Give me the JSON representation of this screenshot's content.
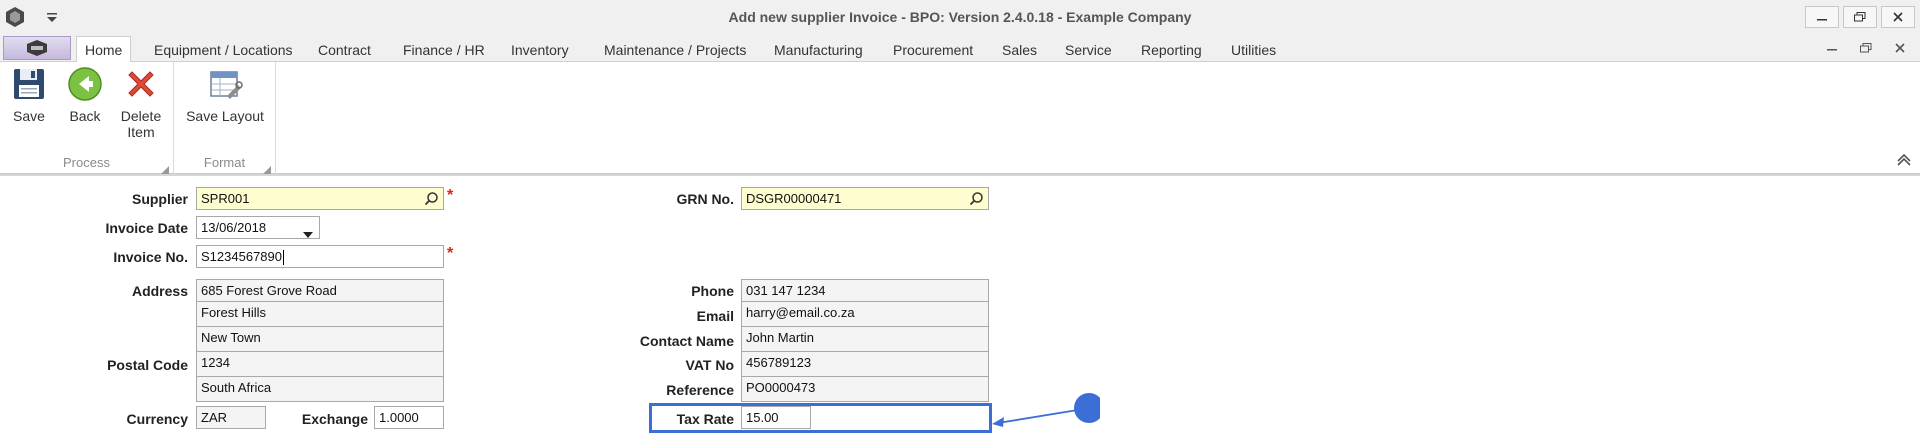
{
  "window": {
    "title": "Add new supplier Invoice - BPO: Version 2.4.0.18 - Example Company"
  },
  "tabs": [
    {
      "label": "Home",
      "active": true
    },
    {
      "label": "Equipment / Locations"
    },
    {
      "label": "Contract"
    },
    {
      "label": "Finance / HR"
    },
    {
      "label": "Inventory"
    },
    {
      "label": "Maintenance / Projects"
    },
    {
      "label": "Manufacturing"
    },
    {
      "label": "Procurement"
    },
    {
      "label": "Sales"
    },
    {
      "label": "Service"
    },
    {
      "label": "Reporting"
    },
    {
      "label": "Utilities"
    }
  ],
  "ribbon": {
    "process": {
      "label": "Process",
      "save": "Save",
      "back": "Back",
      "delete": "Delete Item"
    },
    "format": {
      "label": "Format",
      "save_layout": "Save Layout"
    }
  },
  "form": {
    "supplier": {
      "label": "Supplier",
      "value": "SPR001"
    },
    "invoice_date": {
      "label": "Invoice Date",
      "value": "13/06/2018"
    },
    "invoice_no": {
      "label": "Invoice No.",
      "value": "S1234567890"
    },
    "address": {
      "label": "Address",
      "line1": "685 Forest Grove Road",
      "line2": "Forest Hills",
      "line3": "New Town"
    },
    "postal_code": {
      "label": "Postal Code",
      "value": "1234",
      "country": "South Africa"
    },
    "currency": {
      "label": "Currency",
      "value": "ZAR"
    },
    "exchange": {
      "label": "Exchange",
      "value": "1.0000"
    },
    "grn_no": {
      "label": "GRN No.",
      "value": "DSGR00000471"
    },
    "phone": {
      "label": "Phone",
      "value": "031 147 1234"
    },
    "email": {
      "label": "Email",
      "value": "harry@email.co.za"
    },
    "contact_name": {
      "label": "Contact Name",
      "value": "John Martin"
    },
    "vat_no": {
      "label": "VAT No",
      "value": "456789123"
    },
    "reference": {
      "label": "Reference",
      "value": "PO0000473"
    },
    "tax_rate": {
      "label": "Tax Rate",
      "value": "15.00"
    },
    "required_marker": "*"
  },
  "colors": {
    "required_bg": "#fdfdd0",
    "highlight": "#3b6fd6",
    "required_star": "#e0201a"
  }
}
